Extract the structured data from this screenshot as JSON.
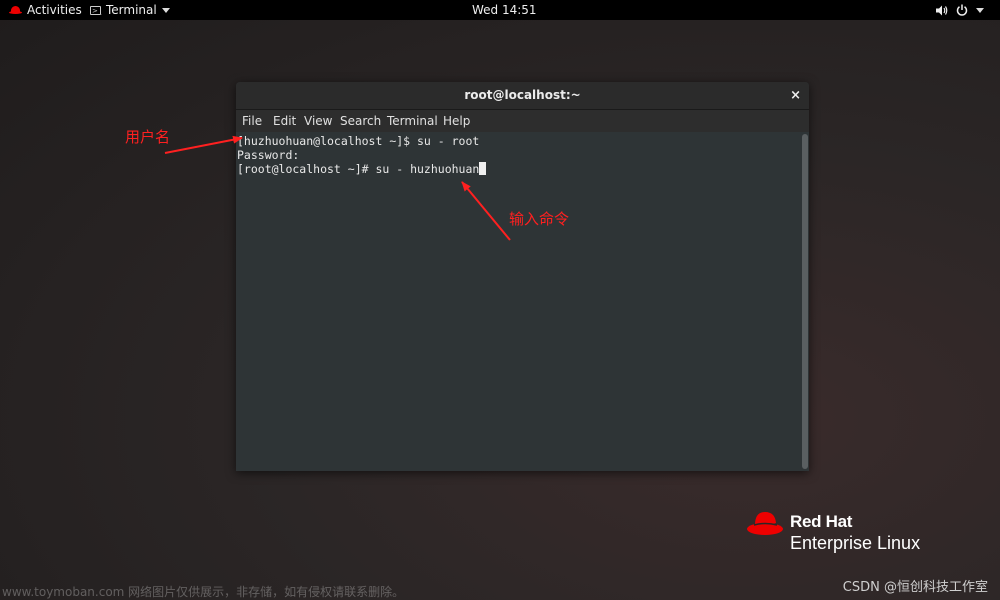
{
  "topbar": {
    "activities": "Activities",
    "app_menu": "Terminal",
    "clock": "Wed 14:51"
  },
  "window": {
    "title": "root@localhost:~",
    "close": "×",
    "menu": [
      "File",
      "Edit",
      "View",
      "Search",
      "Terminal",
      "Help"
    ]
  },
  "terminal": {
    "lines": [
      "[huzhuohuan@localhost ~]$ su - root",
      "Password:",
      "[root@localhost ~]# su - huzhuohuan"
    ]
  },
  "annotations": {
    "username": "用户名",
    "command": "输入命令"
  },
  "brand": {
    "name": "Red Hat",
    "product": "Enterprise Linux"
  },
  "watermarks": {
    "left": "www.toymoban.com 网络图片仅供展示，非存储，如有侵权请联系删除。",
    "right": "CSDN @恒创科技工作室"
  },
  "colors": {
    "annotation": "#ff2020",
    "topbar": "#000000",
    "terminal_bg": "#2e3436",
    "brand_red": "#ee0000"
  }
}
